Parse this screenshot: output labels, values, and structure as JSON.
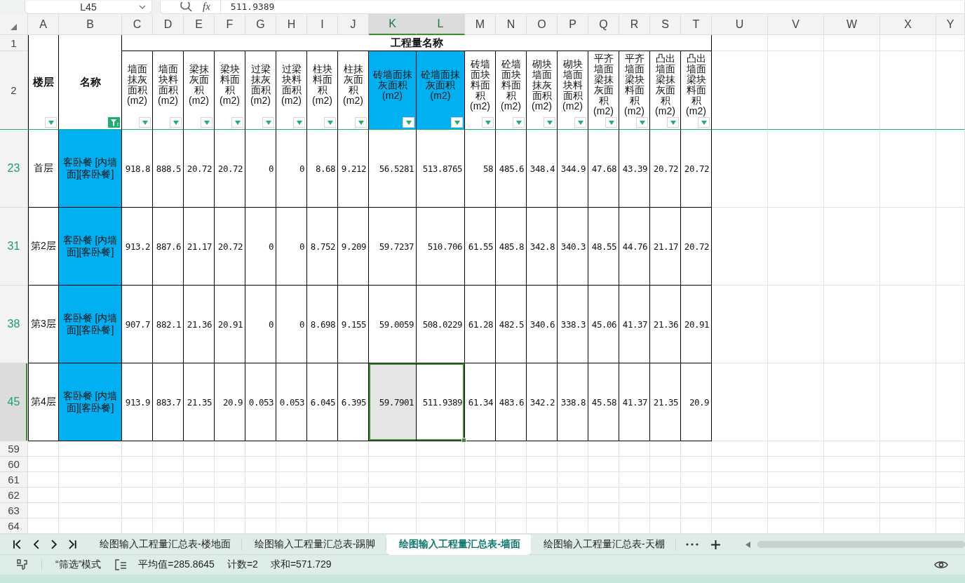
{
  "name_box": "L45",
  "formula_label": "fx",
  "formula": "511.9389",
  "column_letters": [
    {
      "label": "A",
      "selected": false
    },
    {
      "label": "B",
      "selected": false
    },
    {
      "label": "C",
      "selected": false
    },
    {
      "label": "D",
      "selected": false
    },
    {
      "label": "E",
      "selected": false
    },
    {
      "label": "F",
      "selected": false
    },
    {
      "label": "G",
      "selected": false
    },
    {
      "label": "H",
      "selected": false
    },
    {
      "label": "I",
      "selected": false
    },
    {
      "label": "J",
      "selected": false
    },
    {
      "label": "K",
      "selected": true
    },
    {
      "label": "L",
      "selected": true
    },
    {
      "label": "M",
      "selected": false
    },
    {
      "label": "N",
      "selected": false
    },
    {
      "label": "O",
      "selected": false
    },
    {
      "label": "P",
      "selected": false
    },
    {
      "label": "Q",
      "selected": false
    },
    {
      "label": "R",
      "selected": false
    },
    {
      "label": "S",
      "selected": false
    },
    {
      "label": "T",
      "selected": false
    },
    {
      "label": "U",
      "selected": false
    },
    {
      "label": "V",
      "selected": false
    },
    {
      "label": "W",
      "selected": false
    },
    {
      "label": "X",
      "selected": false
    },
    {
      "label": "Y",
      "selected": false
    }
  ],
  "header_row_numbers": [
    "1",
    "2"
  ],
  "header": {
    "floor": {
      "label": "楼层",
      "filter_active": false
    },
    "name": {
      "label": "名称",
      "filter_active": true
    },
    "group": "工程量名称",
    "columns": [
      {
        "label": "墙面抹灰面积(m2)",
        "highlighted": false,
        "filter_active": false
      },
      {
        "label": "墙面块料面积(m2)",
        "highlighted": false,
        "filter_active": false
      },
      {
        "label": "梁抹灰面积(m2)",
        "highlighted": false,
        "filter_active": false
      },
      {
        "label": "梁块料面积(m2)",
        "highlighted": false,
        "filter_active": false
      },
      {
        "label": "过梁抹灰面积(m2)",
        "highlighted": false,
        "filter_active": false
      },
      {
        "label": "过梁块料面积(m2)",
        "highlighted": false,
        "filter_active": false
      },
      {
        "label": "柱块料面积(m2)",
        "highlighted": false,
        "filter_active": false
      },
      {
        "label": "柱抹灰面积(m2)",
        "highlighted": false,
        "filter_active": false
      },
      {
        "label": "砖墙面抹灰面积(m2)",
        "highlighted": true,
        "filter_active": false
      },
      {
        "label": "砼墙面抹灰面积(m2)",
        "highlighted": true,
        "filter_active": false
      },
      {
        "label": "砖墙面块料面积(m2)",
        "highlighted": false,
        "filter_active": false
      },
      {
        "label": "砼墙面块料面积(m2)",
        "highlighted": false,
        "filter_active": false
      },
      {
        "label": "砌块墙面抹灰面积(m2)",
        "highlighted": false,
        "filter_active": false
      },
      {
        "label": "砌块墙面块料面积(m2)",
        "highlighted": false,
        "filter_active": false
      },
      {
        "label": "平齐墙面梁抹灰面积(m2)",
        "highlighted": false,
        "filter_active": false
      },
      {
        "label": "平齐墙面梁块料面积(m2)",
        "highlighted": false,
        "filter_active": false
      },
      {
        "label": "凸出墙面梁抹灰面积(m2)",
        "highlighted": false,
        "filter_active": false
      },
      {
        "label": "凸出墙面梁块料面积(m2)",
        "highlighted": false,
        "filter_active": false
      }
    ]
  },
  "rows": [
    {
      "number": "23",
      "selected": false,
      "floor": "首层",
      "name": "客卧餐 [内墙面][客卧餐]",
      "values": [
        "918.8",
        "888.5",
        "20.72",
        "20.72",
        "0",
        "0",
        "8.68",
        "9.212",
        "56.5281",
        "513.8765",
        "58",
        "485.6",
        "348.4",
        "344.9",
        "47.68",
        "43.39",
        "20.72",
        "20.72"
      ]
    },
    {
      "number": "31",
      "selected": false,
      "floor": "第2层",
      "name": "客卧餐 [内墙面][客卧餐]",
      "values": [
        "913.2",
        "887.6",
        "21.17",
        "20.72",
        "0",
        "0",
        "8.752",
        "9.209",
        "59.7237",
        "510.706",
        "61.55",
        "485.8",
        "342.8",
        "340.3",
        "48.55",
        "44.76",
        "21.17",
        "20.72"
      ]
    },
    {
      "number": "38",
      "selected": false,
      "floor": "第3层",
      "name": "客卧餐 [内墙面][客卧餐]",
      "values": [
        "907.7",
        "882.1",
        "21.36",
        "20.91",
        "0",
        "0",
        "8.698",
        "9.155",
        "59.0059",
        "508.0229",
        "61.28",
        "482.5",
        "340.6",
        "338.3",
        "45.06",
        "41.37",
        "21.36",
        "20.91"
      ]
    },
    {
      "number": "45",
      "selected": true,
      "floor": "第4层",
      "name": "客卧餐 [内墙面][客卧餐]",
      "values": [
        "913.9",
        "883.7",
        "21.35",
        "20.9",
        "0.053",
        "0.053",
        "6.045",
        "6.395",
        "59.7901",
        "511.9389",
        "61.34",
        "483.6",
        "342.2",
        "338.8",
        "45.58",
        "41.37",
        "21.35",
        "20.9"
      ]
    }
  ],
  "empty_rows": [
    "59",
    "60",
    "61",
    "62",
    "63",
    "64"
  ],
  "sheet_tabs": [
    {
      "label": "绘图输入工程量汇总表-楼地面",
      "selected": false
    },
    {
      "label": "绘图输入工程量汇总表-踢脚",
      "selected": false
    },
    {
      "label": "绘图输入工程量汇总表-墙面",
      "selected": true
    },
    {
      "label": "绘图输入工程量汇总表-天棚",
      "selected": false
    }
  ],
  "status_bar": {
    "mode": "“筛选”模式",
    "average": "平均值=285.8645",
    "count": "计数=2",
    "sum": "求和=571.729"
  }
}
